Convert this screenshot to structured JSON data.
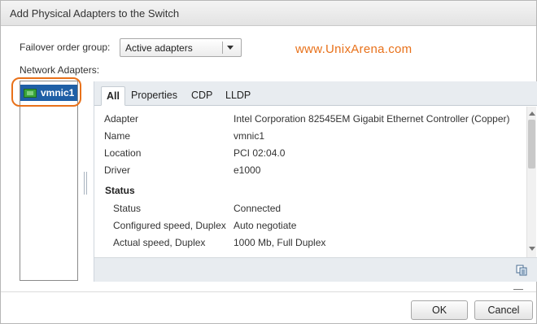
{
  "dialog": {
    "title": "Add Physical Adapters to the Switch"
  },
  "failover": {
    "label": "Failover order group:",
    "selected": "Active adapters"
  },
  "watermark": "www.UnixArena.com",
  "adapters": {
    "label": "Network Adapters:",
    "items": [
      {
        "label": "vmnic1",
        "icon": "network-card-icon",
        "selected": true
      }
    ]
  },
  "tabs": [
    {
      "label": "All",
      "active": true
    },
    {
      "label": "Properties",
      "active": false
    },
    {
      "label": "CDP",
      "active": false
    },
    {
      "label": "LLDP",
      "active": false
    }
  ],
  "details": {
    "rows": [
      {
        "key": "Adapter",
        "value": "Intel Corporation 82545EM Gigabit Ethernet Controller (Copper)"
      },
      {
        "key": "Name",
        "value": "vmnic1"
      },
      {
        "key": "Location",
        "value": "PCI 02:04.0"
      },
      {
        "key": "Driver",
        "value": "e1000"
      }
    ],
    "status_section": {
      "title": "Status",
      "rows": [
        {
          "key": "Status",
          "value": "Connected"
        },
        {
          "key": "Configured speed, Duplex",
          "value": "Auto negotiate"
        },
        {
          "key": "Actual speed, Duplex",
          "value": "1000 Mb, Full Duplex"
        }
      ]
    }
  },
  "buttons": {
    "ok": "OK",
    "cancel": "Cancel"
  },
  "colors": {
    "accent": "#e8711a",
    "selection": "#1f5fa6"
  }
}
